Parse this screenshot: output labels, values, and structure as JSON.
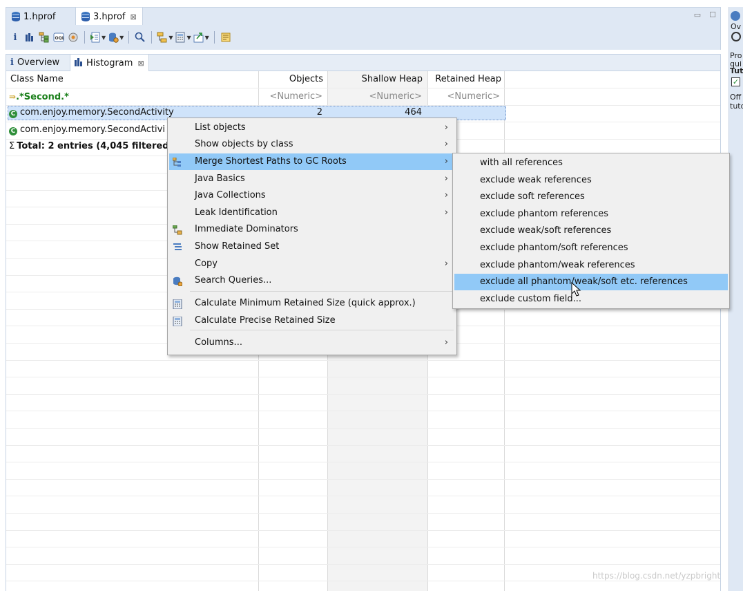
{
  "editor_tabs": [
    {
      "label": "1.hprof",
      "active": false
    },
    {
      "label": "3.hprof",
      "active": true,
      "close": "⊠"
    }
  ],
  "toolbar": {
    "icons": [
      "info-icon",
      "histogram-icon",
      "dominator-tree-icon",
      "oql-icon",
      "thread-overview-icon",
      "run-report-icon",
      "query-browser-icon",
      "find-object-icon",
      "group-by-icon",
      "calculator-icon",
      "export-icon",
      "leak-suspects-icon"
    ],
    "info_glyph": "i"
  },
  "inner_tabs": [
    {
      "label": "Overview",
      "active": false,
      "glyph": "i"
    },
    {
      "label": "Histogram",
      "active": true,
      "close": "⊠"
    }
  ],
  "table": {
    "headers": [
      "Class Name",
      "Objects",
      "Shallow Heap",
      "Retained Heap"
    ],
    "filter_row": {
      "regex": ".*Second.*",
      "objects": "<Numeric>",
      "shallow": "<Numeric>",
      "retained": "<Numeric>"
    },
    "rows": [
      {
        "name": "com.enjoy.memory.SecondActivity",
        "objects": "2",
        "shallow": "464",
        "retained": ""
      },
      {
        "name": "com.enjoy.memory.SecondActivi",
        "objects": "",
        "shallow": "",
        "retained": ""
      }
    ],
    "total": "Total: 2 entries (4,045 filtered)",
    "total_glyph": "Σ"
  },
  "context_menu": {
    "items": [
      {
        "label": "List objects",
        "submenu": true,
        "icon": ""
      },
      {
        "label": "Show objects by class",
        "submenu": true,
        "icon": ""
      },
      {
        "label": "Merge Shortest Paths to GC Roots",
        "submenu": true,
        "icon": "paths-icon",
        "highlighted": true
      },
      {
        "label": "Java Basics",
        "submenu": true,
        "icon": ""
      },
      {
        "label": "Java Collections",
        "submenu": true,
        "icon": ""
      },
      {
        "label": "Leak Identification",
        "submenu": true,
        "icon": ""
      },
      {
        "label": "Immediate Dominators",
        "submenu": false,
        "icon": "dominators-icon"
      },
      {
        "label": "Show Retained Set",
        "submenu": false,
        "icon": "retained-set-icon"
      },
      {
        "label": "Copy",
        "submenu": true,
        "icon": ""
      },
      {
        "label": "Search Queries...",
        "submenu": false,
        "icon": "search-queries-icon"
      },
      {
        "label": "Calculate Minimum Retained Size (quick approx.)",
        "submenu": false,
        "icon": "calculator-icon"
      },
      {
        "label": "Calculate Precise Retained Size",
        "submenu": false,
        "icon": "calculator-icon"
      },
      {
        "label": "Columns...",
        "submenu": true,
        "icon": ""
      }
    ],
    "arrow": "›"
  },
  "sub_menu": {
    "items": [
      {
        "label": "with all references",
        "highlighted": false
      },
      {
        "label": "exclude weak references",
        "highlighted": false
      },
      {
        "label": "exclude soft references",
        "highlighted": false
      },
      {
        "label": "exclude phantom references",
        "highlighted": false
      },
      {
        "label": "exclude weak/soft references",
        "highlighted": false
      },
      {
        "label": "exclude phantom/soft references",
        "highlighted": false
      },
      {
        "label": "exclude phantom/weak references",
        "highlighted": false
      },
      {
        "label": "exclude all phantom/weak/soft etc. references",
        "highlighted": true
      },
      {
        "label": "exclude custom field...",
        "highlighted": false
      }
    ]
  },
  "right_panel": {
    "lines": [
      "Ov",
      "Pro",
      "qui",
      "Tut",
      "Off",
      "tuto"
    ]
  },
  "watermark": "https://blog.csdn.net/yzpbright",
  "colors": {
    "highlight": "#91c9f7",
    "selected_row": "#cfe3fa",
    "chrome": "#dfe8f4",
    "regex_green": "#1a7f1a"
  }
}
